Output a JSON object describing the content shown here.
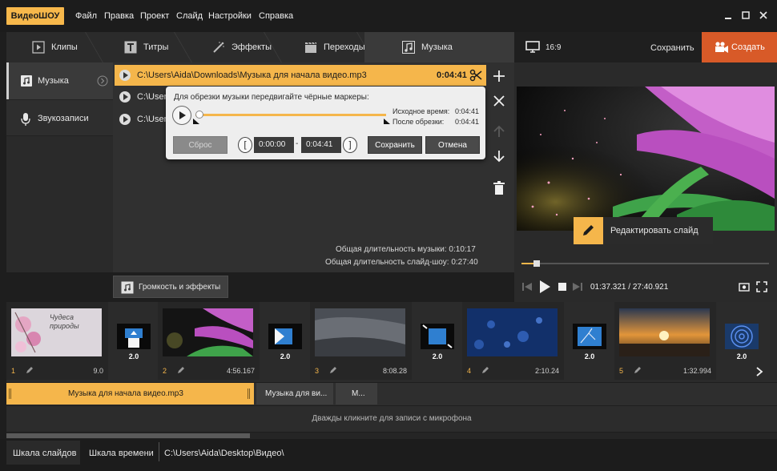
{
  "app": {
    "logo": "ВидеоШОУ"
  },
  "menu": [
    "Файл",
    "Правка",
    "Проект",
    "Слайд",
    "Настройки",
    "Справка"
  ],
  "tabs": [
    {
      "label": "Клипы",
      "icon": "clips-icon"
    },
    {
      "label": "Титры",
      "icon": "titles-icon"
    },
    {
      "label": "Эффекты",
      "icon": "effects-icon"
    },
    {
      "label": "Переходы",
      "icon": "transitions-icon"
    },
    {
      "label": "Музыка",
      "icon": "music-icon"
    }
  ],
  "header": {
    "aspect": "16:9",
    "save": "Сохранить",
    "create": "Создать"
  },
  "sidebar": [
    {
      "label": "Музыка",
      "icon": "music-note-icon"
    },
    {
      "label": "Звукозаписи",
      "icon": "microphone-icon"
    }
  ],
  "tracks": [
    {
      "path": "C:\\Users\\Aida\\Downloads\\Музыка для начала видео.mp3",
      "duration": "0:04:41"
    },
    {
      "path": "C:\\User"
    },
    {
      "path": "C:\\User"
    }
  ],
  "trim": {
    "hint": "Для обрезки музыки передвигайте чёрные маркеры:",
    "orig_label": "Исходное время:",
    "orig_value": "0:04:41",
    "after_label": "После обрезки:",
    "after_value": "0:04:41",
    "reset": "Сброс",
    "start": "0:00:00",
    "sep": "-",
    "end": "0:04:41",
    "save": "Сохранить",
    "cancel": "Отмена"
  },
  "totals": {
    "music": "Общая длительность музыки: 0:10:17",
    "show": "Общая длительность слайд-шоу: 0:27:40"
  },
  "volume_button": "Громкость и эффекты",
  "preview": {
    "edit_slide": "Редактировать слайд",
    "time": "01:37.321 / 27:40.921",
    "progress": 0.06
  },
  "slides": [
    {
      "num": "1",
      "duration": "9.0",
      "caption": "Чудеса природы"
    },
    {
      "num": "2",
      "duration": "4:56.167"
    },
    {
      "num": "3",
      "duration": "8:08.28"
    },
    {
      "num": "4",
      "duration": "2:10.24"
    },
    {
      "num": "5",
      "duration": "1:32.994"
    }
  ],
  "transitions": [
    "2.0",
    "2.0",
    "2.0",
    "2.0",
    "2.0",
    "2.0"
  ],
  "music_track": [
    "Музыка для начала видео.mp3",
    "Музыка для ви...",
    "М..."
  ],
  "mic_hint": "Дважды кликните для записи с микрофона",
  "bottom": {
    "slides_tab": "Шкала слайдов",
    "timeline_tab": "Шкала времени",
    "path": "C:\\Users\\Aida\\Desktop\\Видео\\"
  },
  "colors": {
    "accent": "#f5b64b",
    "create": "#d85a28"
  }
}
